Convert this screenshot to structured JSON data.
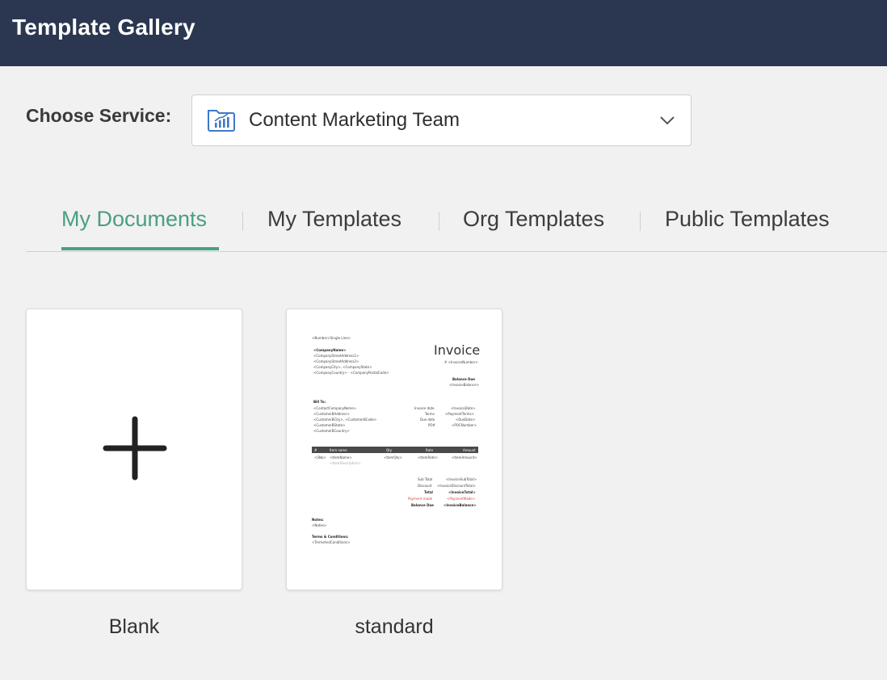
{
  "header": {
    "title": "Template Gallery"
  },
  "service": {
    "label": "Choose Service:",
    "selected": "Content Marketing Team",
    "icon": "folder-chart-icon"
  },
  "tabs": [
    {
      "label": "My Documents",
      "active": true
    },
    {
      "label": "My Templates",
      "active": false
    },
    {
      "label": "Org Templates",
      "active": false
    },
    {
      "label": "Public Templates",
      "active": false
    }
  ],
  "colors": {
    "header_bg": "#2b3750",
    "accent": "#4a9f82"
  },
  "cards": [
    {
      "label": "Blank",
      "icon": "plus-icon"
    },
    {
      "label": "standard"
    }
  ],
  "invoice_preview": {
    "number_field": "<Number>Single Line>",
    "company_name": "<CompanyName>",
    "company_lines": [
      "<CompanyStreetAddress1>",
      "<CompanyStreetAddress2>",
      "<CompanyCity>, <CompanyState>",
      "<CompanyCountry> - <CompanyPostalCode>"
    ],
    "title": "Invoice",
    "invoice_number": "# <InvoiceNumber>",
    "balance_due_label": "Balance Due",
    "balance_due_value": "<InvoiceBalance>",
    "bill_to_label": "Bill To:",
    "bill_to_lines": [
      "<ContactCompanyName>",
      "<CustomerBAddress>",
      "<CustomerBCity>, <CustomerBCode>",
      "<CustomerBState>",
      "<CustomerBCountry>"
    ],
    "meta": [
      {
        "label": "Invoice date",
        "value": "<InvoiceDate>"
      },
      {
        "label": "Terms",
        "value": "<PaymentTerms>"
      },
      {
        "label": "Due date",
        "value": "<DueDate>"
      },
      {
        "label": "PO#",
        "value": "<POCNumber>"
      }
    ],
    "table_headers": [
      "#",
      "Item name",
      "Qty",
      "Rate",
      "Amount"
    ],
    "table_row": [
      "<SNo>",
      "<ItemName>",
      "<ItemQty>",
      "<ItemRate>",
      "<ItemAmount>"
    ],
    "item_description": "<ItemDescription>",
    "totals": [
      {
        "label": "Sub Total",
        "value": "<InvoiceSubTotal>"
      },
      {
        "label": "Discount",
        "value": "<InvoiceDiscountTotal>"
      },
      {
        "label": "Total",
        "value": "<InvoiceTotal>"
      },
      {
        "label": "Payment made",
        "value": "<PaymentMade>"
      },
      {
        "label": "Balance Due",
        "value": "<InvoiceBalance>"
      }
    ],
    "notes_label": "Notes:",
    "notes_value": "<Notes>",
    "terms_label": "Terms & Conditions:",
    "terms_value": "<TermsAndConditions>"
  }
}
